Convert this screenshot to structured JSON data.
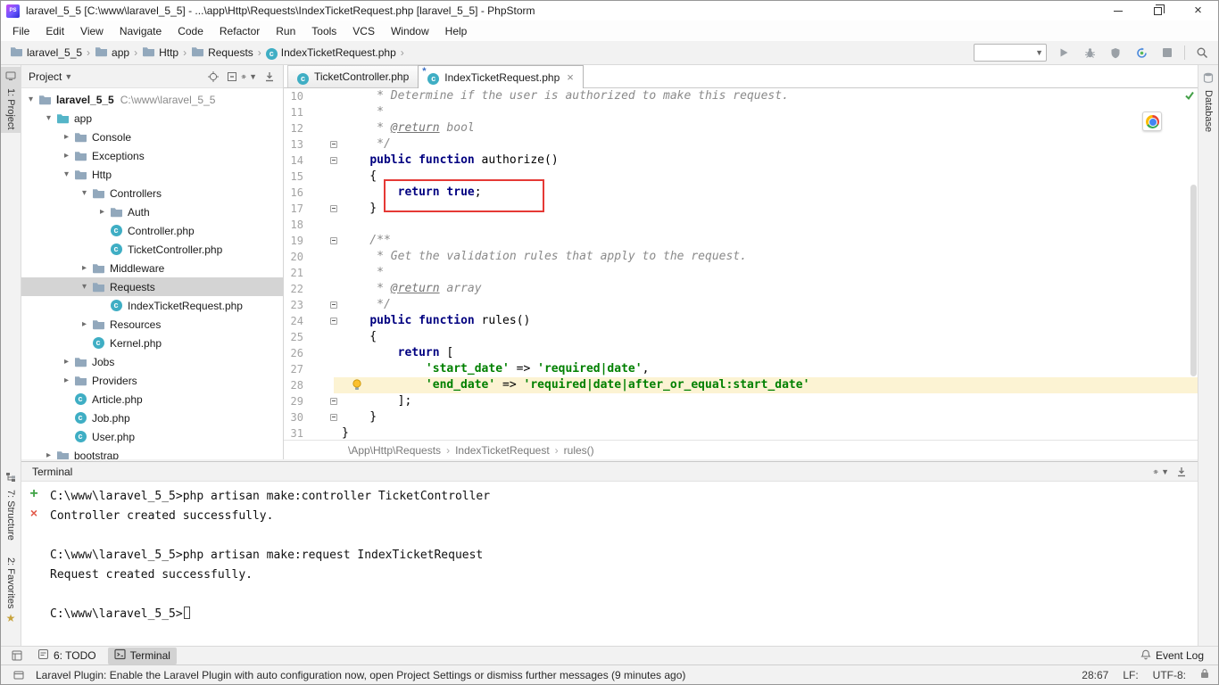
{
  "window": {
    "title": "laravel_5_5 [C:\\www\\laravel_5_5] - ...\\app\\Http\\Requests\\IndexTicketRequest.php [laravel_5_5] - PhpStorm",
    "logo_text": "PS"
  },
  "menu_items": [
    "File",
    "Edit",
    "View",
    "Navigate",
    "Code",
    "Refactor",
    "Run",
    "Tools",
    "VCS",
    "Window",
    "Help"
  ],
  "navbar": {
    "crumbs": [
      {
        "label": "laravel_5_5",
        "icon": "folder"
      },
      {
        "label": "app",
        "icon": "folder"
      },
      {
        "label": "Http",
        "icon": "folder"
      },
      {
        "label": "Requests",
        "icon": "folder"
      },
      {
        "label": "IndexTicketRequest.php",
        "icon": "class"
      }
    ]
  },
  "tool_strips": {
    "project": "1: Project",
    "structure": "7: Structure",
    "favorites": "2: Favorites",
    "database": "Database"
  },
  "project_panel": {
    "title": "Project",
    "tree": [
      {
        "depth": 0,
        "arrow": "open",
        "icon": "folder",
        "label": "laravel_5_5",
        "bold": true,
        "path": "C:\\www\\laravel_5_5"
      },
      {
        "depth": 1,
        "arrow": "open",
        "icon": "folder-src",
        "label": "app"
      },
      {
        "depth": 2,
        "arrow": "closed",
        "icon": "folder",
        "label": "Console"
      },
      {
        "depth": 2,
        "arrow": "closed",
        "icon": "folder",
        "label": "Exceptions"
      },
      {
        "depth": 2,
        "arrow": "open",
        "icon": "folder",
        "label": "Http"
      },
      {
        "depth": 3,
        "arrow": "open",
        "icon": "folder",
        "label": "Controllers"
      },
      {
        "depth": 4,
        "arrow": "closed",
        "icon": "folder",
        "label": "Auth"
      },
      {
        "depth": 4,
        "arrow": "none",
        "icon": "class",
        "label": "Controller.php"
      },
      {
        "depth": 4,
        "arrow": "none",
        "icon": "class",
        "label": "TicketController.php"
      },
      {
        "depth": 3,
        "arrow": "closed",
        "icon": "folder",
        "label": "Middleware"
      },
      {
        "depth": 3,
        "arrow": "open",
        "icon": "folder",
        "label": "Requests",
        "selected": true
      },
      {
        "depth": 4,
        "arrow": "none",
        "icon": "class",
        "label": "IndexTicketRequest.php"
      },
      {
        "depth": 3,
        "arrow": "closed",
        "icon": "folder",
        "label": "Resources"
      },
      {
        "depth": 3,
        "arrow": "none",
        "icon": "class",
        "label": "Kernel.php"
      },
      {
        "depth": 2,
        "arrow": "closed",
        "icon": "folder",
        "label": "Jobs"
      },
      {
        "depth": 2,
        "arrow": "closed",
        "icon": "folder",
        "label": "Providers"
      },
      {
        "depth": 2,
        "arrow": "none",
        "icon": "class",
        "label": "Article.php"
      },
      {
        "depth": 2,
        "arrow": "none",
        "icon": "class",
        "label": "Job.php"
      },
      {
        "depth": 2,
        "arrow": "none",
        "icon": "class",
        "label": "User.php"
      },
      {
        "depth": 1,
        "arrow": "closed",
        "icon": "folder",
        "label": "bootstrap"
      }
    ]
  },
  "editor": {
    "tabs": [
      {
        "label": "TicketController.php",
        "active": false,
        "modified": false,
        "closable": false
      },
      {
        "label": "IndexTicketRequest.php",
        "active": true,
        "modified": true,
        "closable": true
      }
    ],
    "breadcrumbs": [
      "\\App\\Http\\Requests",
      "IndexTicketRequest",
      "rules()"
    ],
    "lines": [
      {
        "num": 10,
        "segs": [
          [
            "cmt",
            "     * Determine if the user is authorized to make this request."
          ]
        ]
      },
      {
        "num": 11,
        "segs": [
          [
            "cmt",
            "     *"
          ]
        ]
      },
      {
        "num": 12,
        "segs": [
          [
            "cmt",
            "     * "
          ],
          [
            "tag",
            "@return"
          ],
          [
            "cmt",
            " bool"
          ]
        ]
      },
      {
        "num": 13,
        "fold": true,
        "segs": [
          [
            "cmt",
            "     */"
          ]
        ]
      },
      {
        "num": 14,
        "fold": true,
        "segs": [
          [
            "pln",
            "    "
          ],
          [
            "kw",
            "public"
          ],
          [
            "pln",
            " "
          ],
          [
            "kw",
            "function"
          ],
          [
            "pln",
            " authorize()"
          ]
        ]
      },
      {
        "num": 15,
        "segs": [
          [
            "pln",
            "    {"
          ]
        ]
      },
      {
        "num": 16,
        "segs": [
          [
            "pln",
            "        "
          ],
          [
            "kw",
            "return"
          ],
          [
            "pln",
            " "
          ],
          [
            "kw",
            "true"
          ],
          [
            "pln",
            ";"
          ]
        ]
      },
      {
        "num": 17,
        "fold": true,
        "segs": [
          [
            "pln",
            "    }"
          ]
        ]
      },
      {
        "num": 18,
        "segs": []
      },
      {
        "num": 19,
        "fold": true,
        "segs": [
          [
            "cmt",
            "    /**"
          ]
        ]
      },
      {
        "num": 20,
        "segs": [
          [
            "cmt",
            "     * Get the validation rules that apply to the request."
          ]
        ]
      },
      {
        "num": 21,
        "segs": [
          [
            "cmt",
            "     *"
          ]
        ]
      },
      {
        "num": 22,
        "segs": [
          [
            "cmt",
            "     * "
          ],
          [
            "tag",
            "@return"
          ],
          [
            "cmt",
            " array"
          ]
        ]
      },
      {
        "num": 23,
        "fold": true,
        "segs": [
          [
            "cmt",
            "     */"
          ]
        ]
      },
      {
        "num": 24,
        "fold": true,
        "segs": [
          [
            "pln",
            "    "
          ],
          [
            "kw",
            "public"
          ],
          [
            "pln",
            " "
          ],
          [
            "kw",
            "function"
          ],
          [
            "pln",
            " rules()"
          ]
        ]
      },
      {
        "num": 25,
        "segs": [
          [
            "pln",
            "    {"
          ]
        ]
      },
      {
        "num": 26,
        "segs": [
          [
            "pln",
            "        "
          ],
          [
            "kw",
            "return"
          ],
          [
            "pln",
            " ["
          ]
        ]
      },
      {
        "num": 27,
        "segs": [
          [
            "pln",
            "            "
          ],
          [
            "str",
            "'start_date'"
          ],
          [
            "pln",
            " => "
          ],
          [
            "str",
            "'required|date'"
          ],
          [
            "pln",
            ","
          ]
        ]
      },
      {
        "num": 28,
        "active": true,
        "bulb": true,
        "segs": [
          [
            "pln",
            "            "
          ],
          [
            "str",
            "'end_date'"
          ],
          [
            "pln",
            " => "
          ],
          [
            "str",
            "'required|date|after_or_equal:start_date'"
          ]
        ]
      },
      {
        "num": 29,
        "fold": true,
        "segs": [
          [
            "pln",
            "        ];"
          ]
        ]
      },
      {
        "num": 30,
        "fold": true,
        "segs": [
          [
            "pln",
            "    }"
          ]
        ]
      },
      {
        "num": 31,
        "segs": [
          [
            "pln",
            "}"
          ]
        ]
      }
    ]
  },
  "terminal": {
    "title": "Terminal",
    "lines": [
      "C:\\www\\laravel_5_5>php artisan make:controller TicketController",
      "Controller created successfully.",
      "",
      "C:\\www\\laravel_5_5>php artisan make:request IndexTicketRequest",
      "Request created successfully.",
      "",
      "C:\\www\\laravel_5_5>"
    ],
    "cursor": true
  },
  "bottom_bar": {
    "todo": "6: TODO",
    "terminal": "Terminal",
    "event_log": "Event Log"
  },
  "status_bar": {
    "message": "Laravel Plugin: Enable the Laravel Plugin with auto configuration now, open Project Settings or dismiss further messages (9 minutes ago)",
    "position": "28:67",
    "line_ending": "LF:",
    "encoding": "UTF-8:"
  },
  "colors": {
    "keyword": "#000080",
    "string": "#008000",
    "comment": "#8a8a8a",
    "selection": "#d4d4d4",
    "active_line": "#fcf3d3",
    "red_box": "#e53935",
    "folder_icon": "#92A8BC",
    "source_folder_icon": "#55B5C8",
    "class_badge": "#3FAEC4"
  }
}
